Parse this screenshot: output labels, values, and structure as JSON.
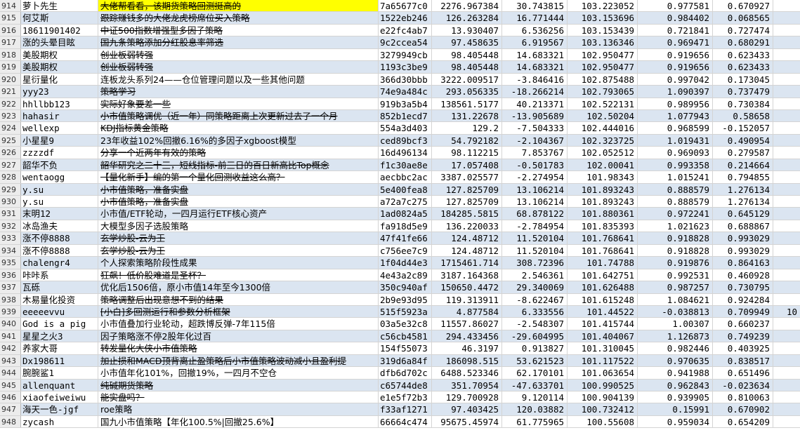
{
  "sheet": {
    "colors": {
      "alt_row": "#dbe5f1",
      "highlight": "#ffff00",
      "row_header": "#ececec"
    },
    "rows": [
      {
        "num": "914",
        "author": "萝卜先生",
        "title": "大佬帮看看，该期货策略回测挺高的",
        "id": "7a65677c0",
        "v1": "2276.967384",
        "v2": "30.743815",
        "v3": "103.223052",
        "v4": "0.977581",
        "v5": "0.670927",
        "v6": "",
        "strike": true,
        "highlight": true,
        "alt": false
      },
      {
        "num": "915",
        "author": "何艾斯",
        "title": "跟踪赚钱多的大佬龙虎榜席位买入策略",
        "id": "1522eb246",
        "v1": "126.263284",
        "v2": "16.771444",
        "v3": "103.153696",
        "v4": "0.984402",
        "v5": "0.068565",
        "v6": "",
        "strike": true,
        "highlight": false,
        "alt": true
      },
      {
        "num": "916",
        "author": "18611901402",
        "title": "中证500指数增强型多因子策略",
        "id": "e22fc4ab7",
        "v1": "13.930407",
        "v2": "6.536256",
        "v3": "103.153439",
        "v4": "0.721841",
        "v5": "0.727474",
        "v6": "",
        "strike": true,
        "highlight": false,
        "alt": false
      },
      {
        "num": "917",
        "author": "涨的头晕目眩",
        "title": "国九条策略添加分红股息率筛选",
        "id": "9c2ccea54",
        "v1": "97.458635",
        "v2": "6.919567",
        "v3": "103.136346",
        "v4": "0.969471",
        "v5": "0.680291",
        "v6": "",
        "strike": true,
        "highlight": false,
        "alt": true
      },
      {
        "num": "918",
        "author": "美股期权",
        "title": "创业板弱转强",
        "id": "3279949cb",
        "v1": "98.405448",
        "v2": "14.683321",
        "v3": "102.950477",
        "v4": "0.919656",
        "v5": "0.623433",
        "v6": "",
        "strike": true,
        "highlight": false,
        "alt": false
      },
      {
        "num": "919",
        "author": "美股期权",
        "title": "创业板弱转强",
        "id": "1193c3be9",
        "v1": "98.405448",
        "v2": "14.683321",
        "v3": "102.950477",
        "v4": "0.919656",
        "v5": "0.623433",
        "v6": "",
        "strike": true,
        "highlight": false,
        "alt": true
      },
      {
        "num": "920",
        "author": "星衍量化",
        "title": "连板龙头系列24——仓位管理问题以及一些其他问题",
        "id": "366d30bbb",
        "v1": "3222.009517",
        "v2": "-3.846416",
        "v3": "102.875488",
        "v4": "0.997042",
        "v5": "0.173045",
        "v6": "",
        "strike": false,
        "highlight": false,
        "alt": false
      },
      {
        "num": "921",
        "author": "yyy23",
        "title": "策略学习",
        "id": "74e9a484c",
        "v1": "293.056335",
        "v2": "-18.266214",
        "v3": "102.793065",
        "v4": "1.090397",
        "v5": "0.737479",
        "v6": "",
        "strike": true,
        "highlight": false,
        "alt": true
      },
      {
        "num": "922",
        "author": "hhllbb123",
        "title": "实际好象要差一些",
        "id": "919b3a5b4",
        "v1": "138561.5177",
        "v2": "40.213371",
        "v3": "102.522131",
        "v4": "0.989956",
        "v5": "0.730384",
        "v6": "",
        "strike": true,
        "highlight": false,
        "alt": false
      },
      {
        "num": "923",
        "author": "hahasir",
        "title": "小市值策略调优（近一年）同策略距离上次更新过去了一个月",
        "id": "852b1ecd7",
        "v1": "131.22678",
        "v2": "-13.905689",
        "v3": "102.50204",
        "v4": "1.077943",
        "v5": "0.58658",
        "v6": "",
        "strike": true,
        "highlight": false,
        "alt": true
      },
      {
        "num": "924",
        "author": "wellexp",
        "title": "KDJ指标黄金策略",
        "id": "554a3d403",
        "v1": "129.2",
        "v2": "-7.504333",
        "v3": "102.444016",
        "v4": "0.968599",
        "v5": "-0.152057",
        "v6": "",
        "strike": true,
        "highlight": false,
        "alt": false
      },
      {
        "num": "925",
        "author": "小星星9",
        "title": "23年收益102%回撤6.16%的多因子xgboost模型",
        "id": "ced89bcf3",
        "v1": "54.792182",
        "v2": "-2.104367",
        "v3": "102.323725",
        "v4": "1.019431",
        "v5": "0.490954",
        "v6": "",
        "strike": false,
        "highlight": false,
        "alt": true
      },
      {
        "num": "926",
        "author": "zzzzdf",
        "title": "分享一个近两年有效的策略",
        "id": "16d496134",
        "v1": "98.112215",
        "v2": "7.853767",
        "v3": "102.052512",
        "v4": "0.969093",
        "v5": "0.279587",
        "v6": "",
        "strike": true,
        "highlight": false,
        "alt": false
      },
      {
        "num": "927",
        "author": "韶华不负",
        "title": "韶华研究之二十三，短线指标-前三日的百日新高比Top概念",
        "id": "f1c30ae8e",
        "v1": "17.057408",
        "v2": "-0.501783",
        "v3": "102.00041",
        "v4": "0.993358",
        "v5": "0.214664",
        "v6": "",
        "strike": true,
        "highlight": false,
        "alt": true
      },
      {
        "num": "928",
        "author": "wentaogg",
        "title": "【量化新手】编的第一个量化回测收益这么高？",
        "id": "aecbbc2ac",
        "v1": "3387.025577",
        "v2": "-2.274954",
        "v3": "101.98343",
        "v4": "1.015241",
        "v5": "0.794855",
        "v6": "",
        "strike": true,
        "highlight": false,
        "alt": false
      },
      {
        "num": "929",
        "author": "y.su",
        "title": "小市值策略，准备实盘",
        "id": "5e400fea8",
        "v1": "127.825709",
        "v2": "13.106214",
        "v3": "101.893243",
        "v4": "0.888579",
        "v5": "1.276134",
        "v6": "",
        "strike": true,
        "highlight": false,
        "alt": true
      },
      {
        "num": "930",
        "author": "y.su",
        "title": "小市值策略，准备实盘",
        "id": "a72a7c275",
        "v1": "127.825709",
        "v2": "13.106214",
        "v3": "101.893243",
        "v4": "0.888579",
        "v5": "1.276134",
        "v6": "",
        "strike": true,
        "highlight": false,
        "alt": false
      },
      {
        "num": "931",
        "author": "末明12",
        "title": "小市值/ETF轮动，一四月运行ETF核心资产",
        "id": "1ad0824a5",
        "v1": "184285.5815",
        "v2": "68.878122",
        "v3": "101.880361",
        "v4": "0.972241",
        "v5": "0.645129",
        "v6": "",
        "strike": false,
        "highlight": false,
        "alt": true
      },
      {
        "num": "932",
        "author": "冰岛渔夫",
        "title": "大模型多因子选股策略",
        "id": "fa918d5e9",
        "v1": "136.220033",
        "v2": "-2.784954",
        "v3": "101.835393",
        "v4": "1.021623",
        "v5": "0.688867",
        "v6": "",
        "strike": false,
        "highlight": false,
        "alt": false
      },
      {
        "num": "933",
        "author": "涨不停8888",
        "title": "玄学炒股-云为王",
        "id": "47f41fe66",
        "v1": "124.48712",
        "v2": "11.520104",
        "v3": "101.768641",
        "v4": "0.918828",
        "v5": "0.993029",
        "v6": "",
        "strike": true,
        "highlight": false,
        "alt": true
      },
      {
        "num": "934",
        "author": "涨不停8888",
        "title": "玄学炒股-云为王",
        "id": "c756ee7c9",
        "v1": "124.48712",
        "v2": "11.520104",
        "v3": "101.768641",
        "v4": "0.918828",
        "v5": "0.993029",
        "v6": "",
        "strike": true,
        "highlight": false,
        "alt": false
      },
      {
        "num": "935",
        "author": "chalengr4",
        "title": "个人探索策略阶段性成果",
        "id": "1f04d44e3",
        "v1": "1715461.714",
        "v2": "308.72396",
        "v3": "101.74788",
        "v4": "0.919876",
        "v5": "0.864163",
        "v6": "",
        "strike": false,
        "highlight": false,
        "alt": true
      },
      {
        "num": "936",
        "author": "咔咔系",
        "title": "狂飙！低价股难道是圣杯？",
        "id": "4e43a2c89",
        "v1": "3187.164368",
        "v2": "2.546361",
        "v3": "101.642751",
        "v4": "0.992531",
        "v5": "0.460928",
        "v6": "",
        "strike": true,
        "highlight": false,
        "alt": false
      },
      {
        "num": "937",
        "author": "瓦砾",
        "title": "优化后1506倍，原小市值14年至今1300倍",
        "id": "350c940af",
        "v1": "150650.4472",
        "v2": "29.340069",
        "v3": "101.626488",
        "v4": "0.987257",
        "v5": "0.730795",
        "v6": "",
        "strike": false,
        "highlight": false,
        "alt": true
      },
      {
        "num": "938",
        "author": "木易量化投资",
        "title": "策略调整后出现意想不到的结果",
        "id": "2b9e93d95",
        "v1": "119.313911",
        "v2": "-8.622467",
        "v3": "101.615248",
        "v4": "1.084621",
        "v5": "0.924284",
        "v6": "",
        "strike": true,
        "highlight": false,
        "alt": false
      },
      {
        "num": "939",
        "author": "eeeeevvu",
        "title": "[小白]多回测运行和参数分析框架",
        "id": "515f5923a",
        "v1": "4.877584",
        "v2": "6.333556",
        "v3": "101.44522",
        "v4": "-0.038813",
        "v5": "0.709949",
        "v6": "10",
        "strike": true,
        "highlight": false,
        "alt": true
      },
      {
        "num": "940",
        "author": "God is a pig",
        "title": "小市值叠加行业轮动，超跌博反弹-7年115倍",
        "id": "03a5e32c8",
        "v1": "11557.86027",
        "v2": "-2.548307",
        "v3": "101.415744",
        "v4": "1.00307",
        "v5": "0.660237",
        "v6": "",
        "strike": false,
        "highlight": false,
        "alt": false
      },
      {
        "num": "941",
        "author": "星星之火3",
        "title": "因子策略涨不停2股年化过百",
        "id": "c56cb4581",
        "v1": "294.433456",
        "v2": "-29.604995",
        "v3": "101.404067",
        "v4": "1.126873",
        "v5": "0.749239",
        "v6": "",
        "strike": false,
        "highlight": false,
        "alt": true
      },
      {
        "num": "942",
        "author": "养家大哥",
        "title": "转发量化大侠小市值策略",
        "id": "154f55073",
        "v1": "46.3197",
        "v2": "0.913827",
        "v3": "101.310045",
        "v4": "0.982446",
        "v5": "0.403925",
        "v6": "",
        "strike": true,
        "highlight": false,
        "alt": false
      },
      {
        "num": "943",
        "author": "Dx198611",
        "title": "加止损和MACD顶背离止盈策略后小市值策略波动减小且盈利提",
        "id": "319d6a84f",
        "v1": "186098.515",
        "v2": "53.621523",
        "v3": "101.117522",
        "v4": "0.970635",
        "v5": "0.838517",
        "v6": "",
        "strike": true,
        "highlight": false,
        "alt": true
      },
      {
        "num": "944",
        "author": "腕腕鲨1",
        "title": "小市值年化101%，回撤19%，一四月不空仓",
        "id": "dfb6d702c",
        "v1": "6488.523346",
        "v2": "62.170101",
        "v3": "101.063654",
        "v4": "0.941988",
        "v5": "0.651496",
        "v6": "",
        "strike": false,
        "highlight": false,
        "alt": false
      },
      {
        "num": "945",
        "author": "allenquant",
        "title": "纯碱期货策略",
        "id": "c65744de8",
        "v1": "351.70954",
        "v2": "-47.633701",
        "v3": "100.990525",
        "v4": "0.962843",
        "v5": "-0.023634",
        "v6": "",
        "strike": true,
        "highlight": false,
        "alt": true
      },
      {
        "num": "946",
        "author": "xiaofeiweiwu",
        "title": "能实盘吗？",
        "id": "e1e5f72b3",
        "v1": "129.700928",
        "v2": "9.120114",
        "v3": "100.904139",
        "v4": "0.939905",
        "v5": "0.810063",
        "v6": "",
        "strike": true,
        "highlight": false,
        "alt": false
      },
      {
        "num": "947",
        "author": "海天一色-jgf",
        "title": "roe策略",
        "id": "f33af1271",
        "v1": "97.403425",
        "v2": "120.03882",
        "v3": "100.732412",
        "v4": "0.15991",
        "v5": "0.670902",
        "v6": "",
        "strike": false,
        "highlight": false,
        "alt": true
      },
      {
        "num": "948",
        "author": "zycash",
        "title": "国九小市值策略【年化100.5%|回撤25.6%】",
        "id": "66664c474",
        "v1": "95675.45974",
        "v2": "61.775965",
        "v3": "100.55608",
        "v4": "0.959034",
        "v5": "0.654209",
        "v6": "",
        "strike": false,
        "highlight": false,
        "alt": false
      }
    ]
  }
}
